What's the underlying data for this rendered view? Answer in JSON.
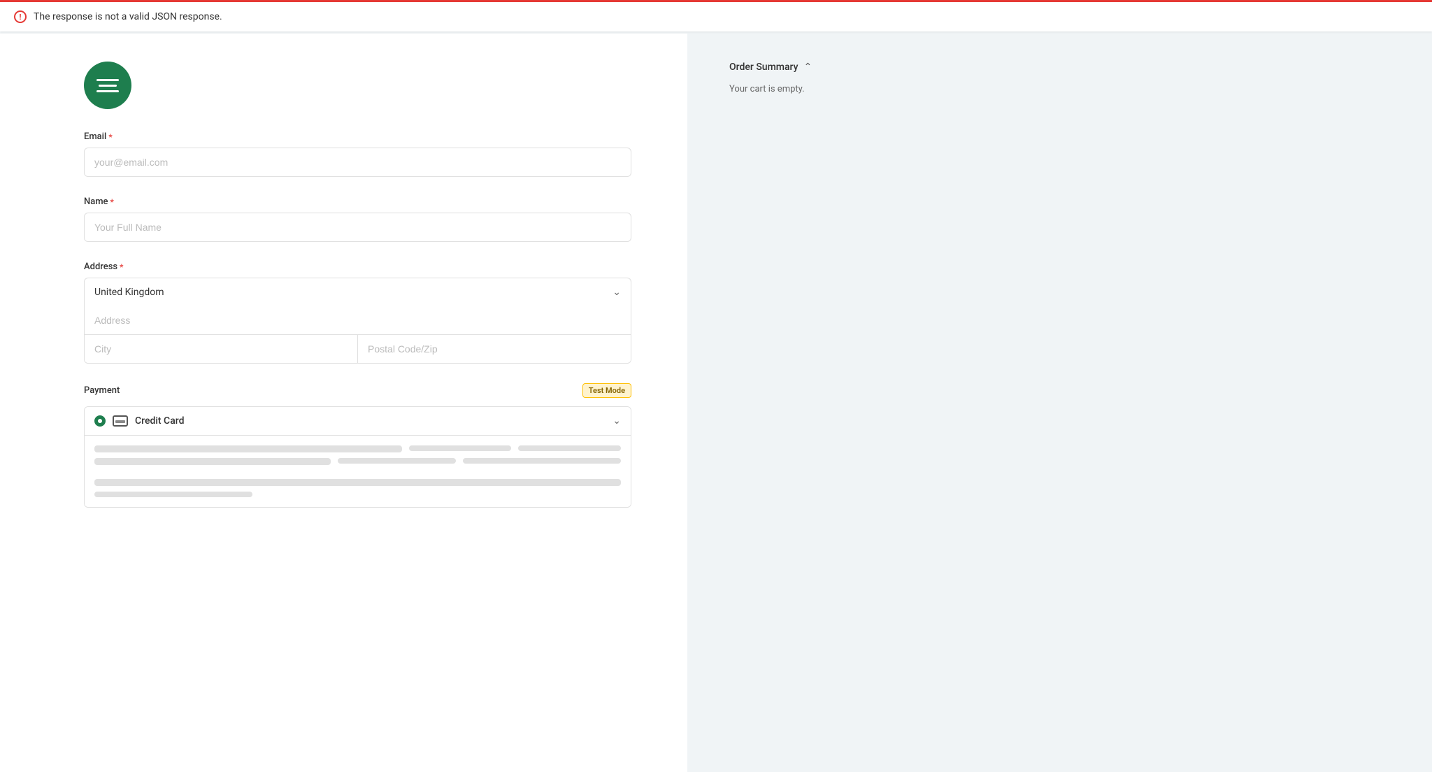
{
  "error_banner": {
    "message": "The response is not a valid JSON response."
  },
  "left_panel": {
    "logo_alt": "Company Logo",
    "email_label": "Email",
    "email_placeholder": "your@email.com",
    "name_label": "Name",
    "name_placeholder": "Your Full Name",
    "address_label": "Address",
    "address_country": "United Kingdom",
    "address_placeholder": "Address",
    "city_placeholder": "City",
    "zip_placeholder": "Postal Code/Zip",
    "payment_label": "Payment",
    "test_mode_badge": "Test Mode",
    "credit_card_label": "Credit Card"
  },
  "right_panel": {
    "order_summary_label": "Order Summary",
    "cart_empty_text": "Your cart is empty."
  }
}
